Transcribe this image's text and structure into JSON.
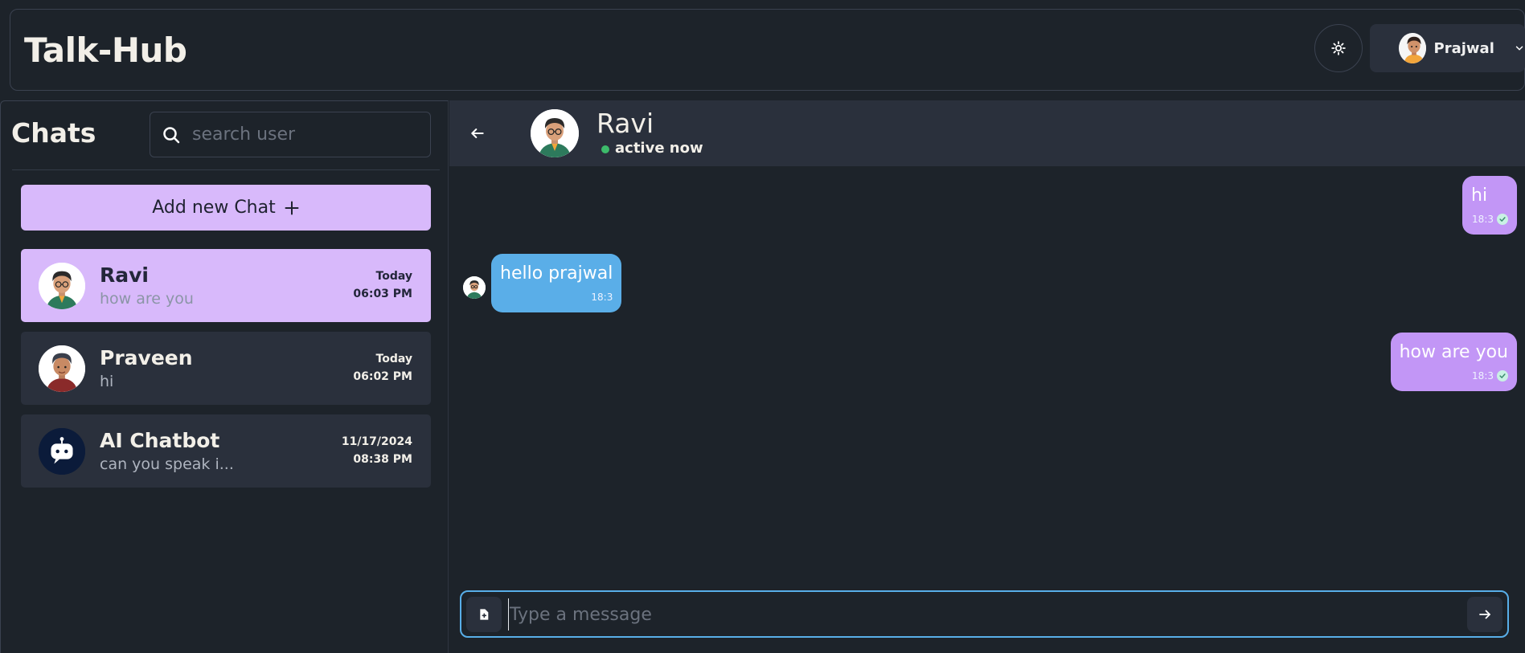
{
  "app": {
    "title": "Talk-Hub"
  },
  "header": {
    "theme_icon": "sun-icon",
    "user": {
      "name": "Prajwal",
      "menu_icon": "chevron-down-icon"
    }
  },
  "sidebar": {
    "title": "Chats",
    "search": {
      "placeholder": "search user",
      "icon": "search-icon"
    },
    "add_button": {
      "label": "Add new Chat",
      "icon": "plus-icon"
    },
    "chats": [
      {
        "name": "Ravi",
        "preview": "how are you",
        "date": "Today",
        "time": "06:03 PM",
        "active": true
      },
      {
        "name": "Praveen",
        "preview": "hi",
        "date": "Today",
        "time": "06:02 PM",
        "active": false
      },
      {
        "name": "AI Chatbot",
        "preview": "can you speak i...",
        "date": "11/17/2024",
        "time": "08:38 PM",
        "active": false
      }
    ]
  },
  "conversation": {
    "contact": {
      "name": "Ravi",
      "status": "active now"
    },
    "messages": [
      {
        "direction": "out",
        "text": "hi",
        "time": "18:3",
        "read": true
      },
      {
        "direction": "in",
        "text": "hello prajwal",
        "time": "18:3"
      },
      {
        "direction": "out",
        "text": "how are you",
        "time": "18:3",
        "read": true
      }
    ],
    "composer": {
      "placeholder": "Type a message",
      "attach_icon": "file-plus-icon",
      "send_icon": "arrow-right-icon"
    }
  },
  "colors": {
    "background": "#1d232a",
    "panel": "#2a303c",
    "accent_purple": "#d8b9fb",
    "outgoing_bubble": "#c296f6",
    "incoming_bubble": "#5aaee8",
    "online": "#3dbb6b"
  }
}
